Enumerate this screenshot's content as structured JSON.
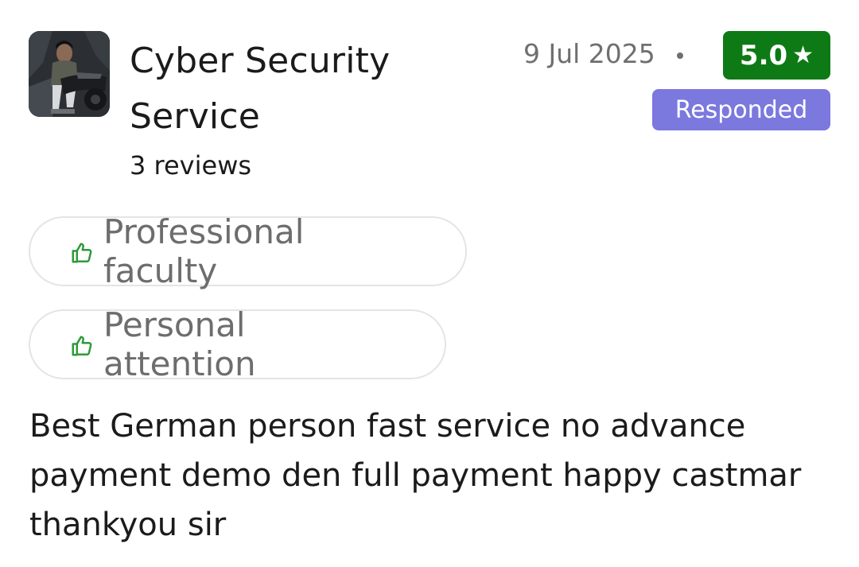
{
  "reviewer": {
    "name": "Cyber Security Service",
    "review_count": "3 reviews",
    "avatar_icon": "user-photo-avatar"
  },
  "review": {
    "date": "9 Jul 2025",
    "rating": "5.0",
    "rating_star": "★",
    "rating_color": "#0e7a16",
    "status": "Responded",
    "status_color": "#7b78de",
    "tags": [
      {
        "icon": "thumbs-up-icon",
        "label": "Professional faculty"
      },
      {
        "icon": "thumbs-up-icon",
        "label": "Personal attention"
      }
    ],
    "text": "Best German person fast service no advance payment demo den full payment happy castmar thankyou sir"
  }
}
